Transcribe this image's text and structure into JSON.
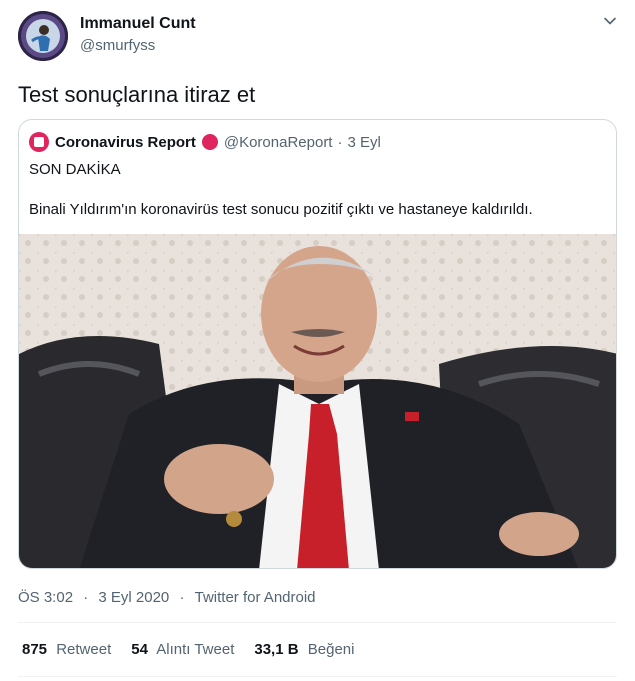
{
  "author": {
    "name": "Immanuel Cunt",
    "handle": "@smurfyss"
  },
  "tweet_text": "Test sonuçlarına itiraz et",
  "quoted": {
    "name": "Coronavirus Report",
    "handle": "@KoronaReport",
    "separator": "·",
    "date": "3 Eyl",
    "line1": "SON DAKİKA",
    "line2": "Binali Yıldırım'ın koronavirüs test sonucu pozitif çıktı ve hastaneye kaldırıldı."
  },
  "meta": {
    "time": "ÖS 3:02",
    "date": "3 Eyl 2020",
    "source": "Twitter for Android",
    "sep": "·"
  },
  "stats": {
    "retweets": {
      "count": "875",
      "label": "Retweet"
    },
    "quotes": {
      "count": "54",
      "label": "Alıntı Tweet"
    },
    "likes": {
      "count": "33,1 B",
      "label": "Beğeni"
    }
  },
  "colors": {
    "accent_red": "#e0245e",
    "muted": "#536471",
    "border": "#cfd9de"
  },
  "icons": [
    "chevron-down-icon",
    "news-logo-icon",
    "red-circle-icon"
  ]
}
